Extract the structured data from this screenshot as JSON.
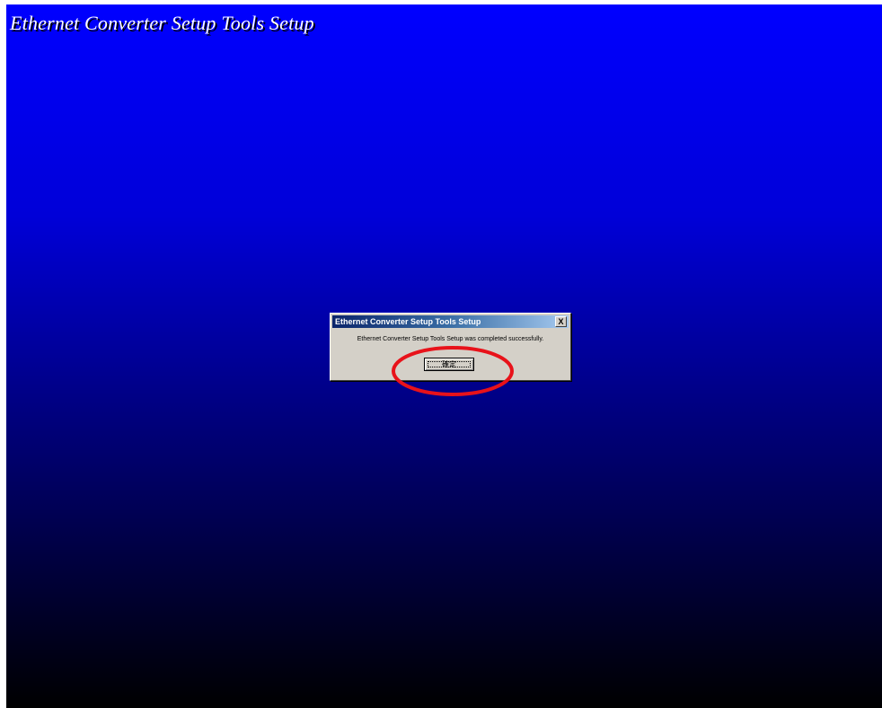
{
  "window": {
    "title": "Ethernet Converter Setup Tools Setup"
  },
  "dialog": {
    "title": "Ethernet Converter Setup Tools Setup",
    "close_glyph": "X",
    "message": "Ethernet Converter Setup Tools Setup was completed successfully.",
    "ok_label": "確定"
  },
  "annotation": {
    "shape": "ellipse",
    "color": "#e8121a",
    "target": "ok-button"
  },
  "colors": {
    "background_top": "#0000ff",
    "background_bottom": "#000000",
    "dialog_face": "#d4d0c8",
    "titlebar_start": "#0a246a",
    "titlebar_end": "#a6caf0"
  }
}
